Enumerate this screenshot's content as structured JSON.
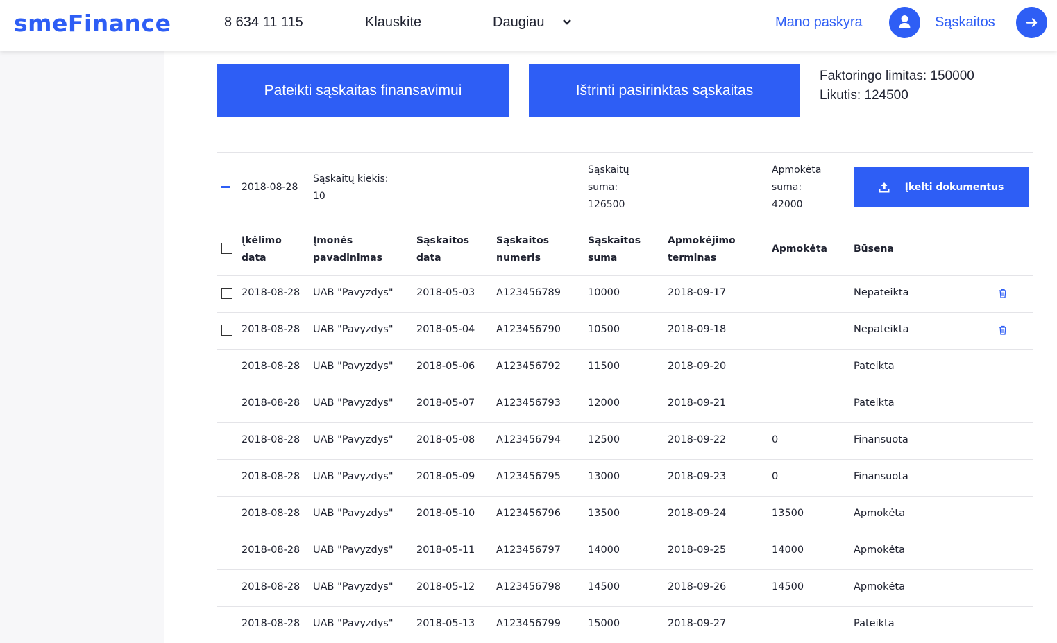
{
  "header": {
    "logo": "smeFinance",
    "phone": "8 634 11 115",
    "ask": "Klauskite",
    "more": "Daugiau",
    "account": "Mano paskyra",
    "invoices": "Sąskaitos"
  },
  "actions": {
    "submit": "Pateikti sąskaitas finansavimui",
    "delete": "Ištrinti pasirinktas sąskaitas",
    "limit": "Faktoringo limitas: 150000",
    "balance": "Likutis: 124500"
  },
  "group": {
    "date": "2018-08-28",
    "count_label": "Sąskaitų kiekis:",
    "count": "10",
    "sum_label_1": "Sąskaitų",
    "sum_label_2": "suma:",
    "sum": "126500",
    "paid_label_1": "Apmokėta",
    "paid_label_2": "suma:",
    "paid": "42000",
    "upload": "Įkelti dokumentus"
  },
  "table": {
    "headers": [
      [
        "Įkėlimo",
        "data"
      ],
      [
        "Įmonės",
        "pavadinimas"
      ],
      [
        "Sąskaitos",
        "data"
      ],
      [
        "Sąskaitos",
        "numeris"
      ],
      [
        "Sąskaitos",
        "suma"
      ],
      [
        "Apmokėjimo",
        "terminas"
      ],
      [
        "Apmokėta",
        ""
      ],
      [
        "Būsena",
        ""
      ]
    ],
    "rows": [
      {
        "upload": "2018-08-28",
        "company": "UAB \"Pavyzdys\"",
        "date": "2018-05-03",
        "number": "A123456789",
        "sum": "10000",
        "term": "2018-09-17",
        "paid": "",
        "status": "Nepateikta",
        "selectable": true
      },
      {
        "upload": "2018-08-28",
        "company": "UAB \"Pavyzdys\"",
        "date": "2018-05-04",
        "number": "A123456790",
        "sum": "10500",
        "term": "2018-09-18",
        "paid": "",
        "status": "Nepateikta",
        "selectable": true
      },
      {
        "upload": "2018-08-28",
        "company": "UAB \"Pavyzdys\"",
        "date": "2018-05-06",
        "number": "A123456792",
        "sum": "11500",
        "term": "2018-09-20",
        "paid": "",
        "status": "Pateikta",
        "selectable": false
      },
      {
        "upload": "2018-08-28",
        "company": "UAB \"Pavyzdys\"",
        "date": "2018-05-07",
        "number": "A123456793",
        "sum": "12000",
        "term": "2018-09-21",
        "paid": "",
        "status": "Pateikta",
        "selectable": false
      },
      {
        "upload": "2018-08-28",
        "company": "UAB \"Pavyzdys\"",
        "date": "2018-05-08",
        "number": "A123456794",
        "sum": "12500",
        "term": "2018-09-22",
        "paid": "0",
        "status": "Finansuota",
        "selectable": false
      },
      {
        "upload": "2018-08-28",
        "company": "UAB \"Pavyzdys\"",
        "date": "2018-05-09",
        "number": "A123456795",
        "sum": "13000",
        "term": "2018-09-23",
        "paid": "0",
        "status": "Finansuota",
        "selectable": false
      },
      {
        "upload": "2018-08-28",
        "company": "UAB \"Pavyzdys\"",
        "date": "2018-05-10",
        "number": "A123456796",
        "sum": "13500",
        "term": "2018-09-24",
        "paid": "13500",
        "status": "Apmokėta",
        "selectable": false
      },
      {
        "upload": "2018-08-28",
        "company": "UAB \"Pavyzdys\"",
        "date": "2018-05-11",
        "number": "A123456797",
        "sum": "14000",
        "term": "2018-09-25",
        "paid": "14000",
        "status": "Apmokėta",
        "selectable": false
      },
      {
        "upload": "2018-08-28",
        "company": "UAB \"Pavyzdys\"",
        "date": "2018-05-12",
        "number": "A123456798",
        "sum": "14500",
        "term": "2018-09-26",
        "paid": "14500",
        "status": "Apmokėta",
        "selectable": false
      },
      {
        "upload": "2018-08-28",
        "company": "UAB \"Pavyzdys\"",
        "date": "2018-05-13",
        "number": "A123456799",
        "sum": "15000",
        "term": "2018-09-27",
        "paid": "",
        "status": "Pateikta",
        "selectable": false
      }
    ]
  },
  "icons": {
    "trash": "trash-icon",
    "user": "user-icon",
    "arrow": "arrow-right-icon",
    "upload": "upload-icon",
    "collapse": "minus-icon"
  },
  "colors": {
    "accent": "#2e5ef5",
    "text": "#1f2230",
    "sidebar": "#f7f7f9",
    "divider": "#e4e4e8"
  }
}
